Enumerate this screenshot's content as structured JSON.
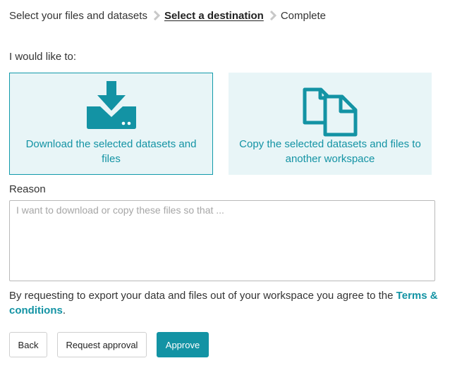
{
  "breadcrumb": {
    "steps": [
      {
        "label": "Select your files and datasets",
        "state": "done"
      },
      {
        "label": "Select a destination",
        "state": "current"
      },
      {
        "label": "Complete",
        "state": "pending"
      }
    ],
    "separator_icon": "chevron-right-icon"
  },
  "prompt": "I would like to:",
  "options": {
    "download": {
      "icon": "download-icon",
      "label": "Download the selected datasets and files",
      "selected": true
    },
    "copy": {
      "icon": "copy-files-icon",
      "label": "Copy the selected datasets and files to another workspace",
      "selected": false
    }
  },
  "reason": {
    "label": "Reason",
    "value": "",
    "placeholder": "I want to download or copy these files so that ..."
  },
  "terms": {
    "text": "By requesting to export your data and files out of your workspace you agree to the ",
    "link": "Terms & conditions",
    "suffix": "."
  },
  "buttons": {
    "back": "Back",
    "request_approval": "Request approval",
    "approve": "Approve"
  },
  "colors": {
    "accent": "#1393a4",
    "option_bg": "#e8f5f7",
    "selected_border": "#119aaa",
    "separator": "#c8c8c8"
  }
}
